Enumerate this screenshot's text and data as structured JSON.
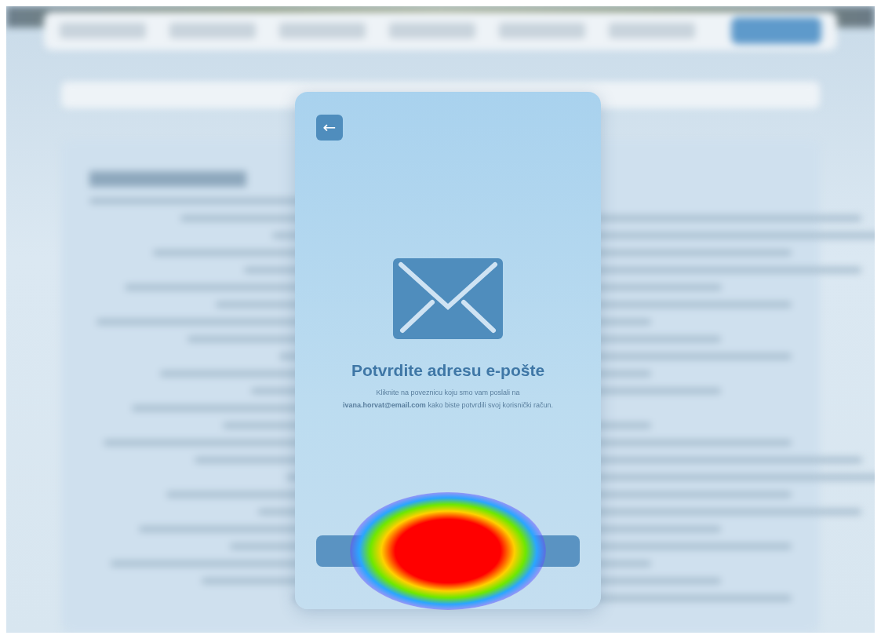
{
  "modal": {
    "back_button": "←",
    "title": "Potvrdite adresu e-pošte",
    "message": "Kliknite na poveznicu koju smo vam poslali na **ivana.horvat@email.com** kako biste potvrdili svoj korisnički račun."
  },
  "heatmap": {
    "visible": true
  }
}
